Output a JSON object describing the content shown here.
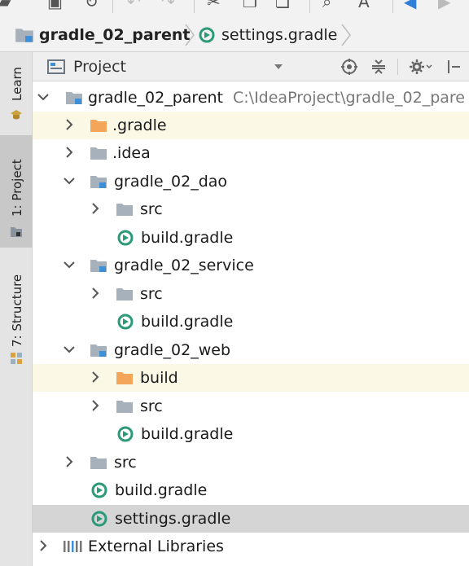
{
  "toolbar": {
    "icons": [
      "open-icon",
      "save-icon",
      "sync-icon",
      "undo-icon",
      "redo-icon",
      "cut-icon",
      "copy-icon",
      "paste-icon",
      "find-icon",
      "replace-icon",
      "back-icon",
      "forward-icon"
    ]
  },
  "breadcrumb": {
    "project": "gradle_02_parent",
    "file": "settings.gradle"
  },
  "left_strip": {
    "learn": "Learn",
    "project": "1: Project",
    "structure": "7: Structure"
  },
  "panel": {
    "view_mode": "Project"
  },
  "tree": {
    "root": {
      "label": "gradle_02_parent",
      "path": "C:\\IdeaProject\\gradle_02_pare"
    },
    "gradle_dir": ".gradle",
    "idea_dir": ".idea",
    "dao": {
      "label": "gradle_02_dao",
      "src": "src",
      "build": "build.gradle"
    },
    "service": {
      "label": "gradle_02_service",
      "src": "src",
      "build": "build.gradle"
    },
    "web": {
      "label": "gradle_02_web",
      "build_dir": "build",
      "src": "src",
      "build": "build.gradle"
    },
    "src": "src",
    "build_gradle": "build.gradle",
    "settings_gradle": "settings.gradle",
    "external": "External Libraries"
  },
  "colors": {
    "highlight_row": "#fbf8e6",
    "selected_row": "#d5d5d5",
    "excluded_folder": "#f0a050",
    "module_folder": "#9aa9b8",
    "gradle_icon": "#2b9a78"
  }
}
